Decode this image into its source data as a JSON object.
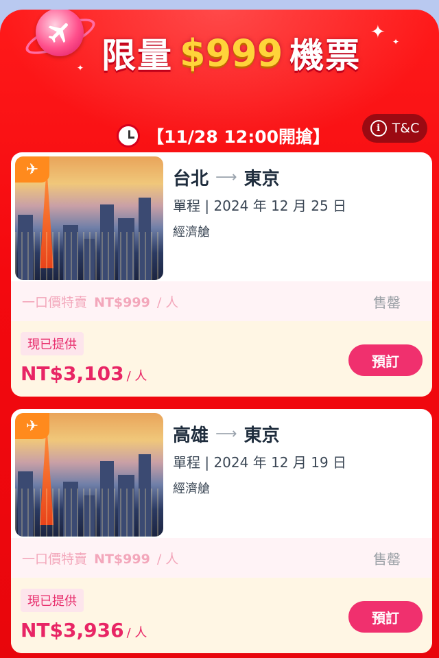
{
  "header": {
    "title_pre": "限量",
    "title_price": "$999",
    "title_post": "機票",
    "countdown": "【11/28 12:00開搶】",
    "tnc_label": "T&C"
  },
  "flights": [
    {
      "origin": "台北",
      "destination": "東京",
      "date_line": "單程 | 2024 年 12 月 25 日",
      "cabin": "經濟艙",
      "promo_label": "一口價特賣",
      "promo_price": "NT$999",
      "promo_unit": "/ 人",
      "status": "售罄",
      "offer_tag": "現已提供",
      "price": "NT$3,103",
      "price_unit": "/ 人",
      "book_label": "預訂"
    },
    {
      "origin": "高雄",
      "destination": "東京",
      "date_line": "單程 | 2024 年 12 月 19 日",
      "cabin": "經濟艙",
      "promo_label": "一口價特賣",
      "promo_price": "NT$999",
      "promo_unit": "/ 人",
      "status": "售罄",
      "offer_tag": "現已提供",
      "price": "NT$3,936",
      "price_unit": "/ 人",
      "book_label": "預訂"
    }
  ],
  "icons": {
    "logo": "airplane-icon",
    "clock": "alarm-clock-icon",
    "info": "info-icon",
    "flight_badge": "airplane-icon"
  },
  "colors": {
    "primary_red": "#f4090f",
    "accent_pink": "#f0306e",
    "gold": "#ffd43a"
  }
}
